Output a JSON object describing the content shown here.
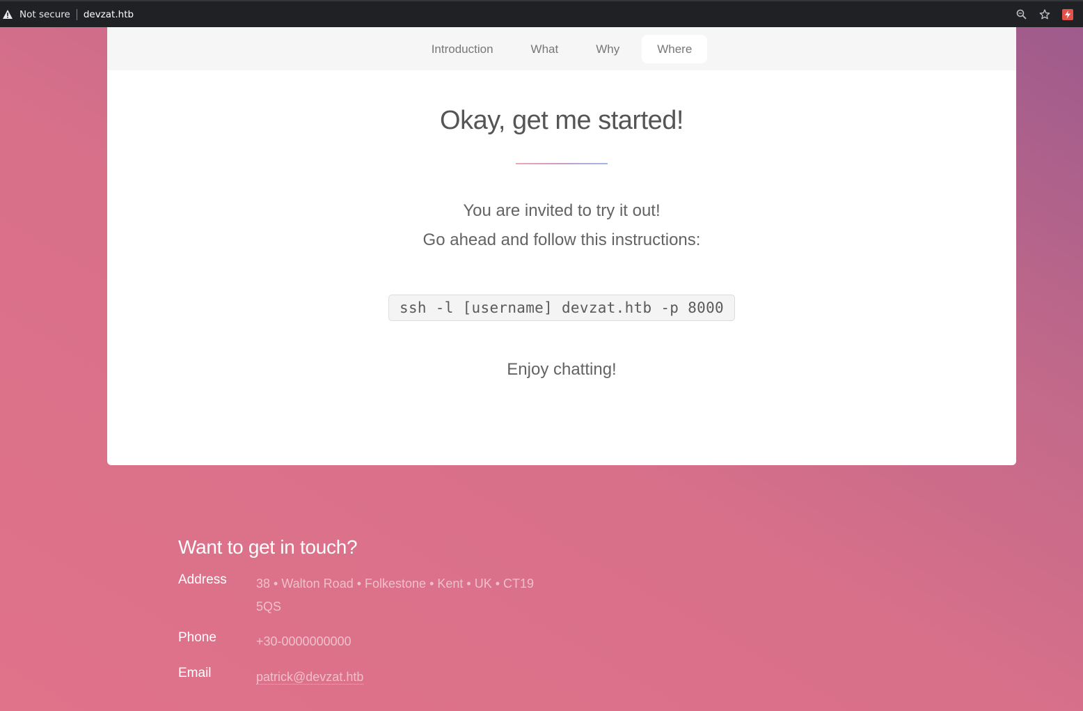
{
  "browser": {
    "security_label": "Not secure",
    "url": "devzat.htb",
    "icons": [
      "warning-icon",
      "zoom-icon",
      "bookmark-star-icon",
      "extension-icon"
    ]
  },
  "nav": {
    "items": [
      {
        "label": "Introduction",
        "active": false
      },
      {
        "label": "What",
        "active": false
      },
      {
        "label": "Why",
        "active": false
      },
      {
        "label": "Where",
        "active": true
      }
    ]
  },
  "section": {
    "title": "Okay, get me started!",
    "line1": "You are invited to try it out!",
    "line2": "Go ahead and follow this instructions:",
    "command": "ssh -l [username] devzat.htb -p 8000",
    "closing": "Enjoy chatting!"
  },
  "footer": {
    "title": "Want to get in touch?",
    "address_label": "Address",
    "address_line1": "38 • Walton Road • Folkestone • Kent • UK • CT19",
    "address_line2": "5QS",
    "phone_label": "Phone",
    "phone": "+30-0000000000",
    "email_label": "Email",
    "email": "patrick@devzat.htb"
  }
}
